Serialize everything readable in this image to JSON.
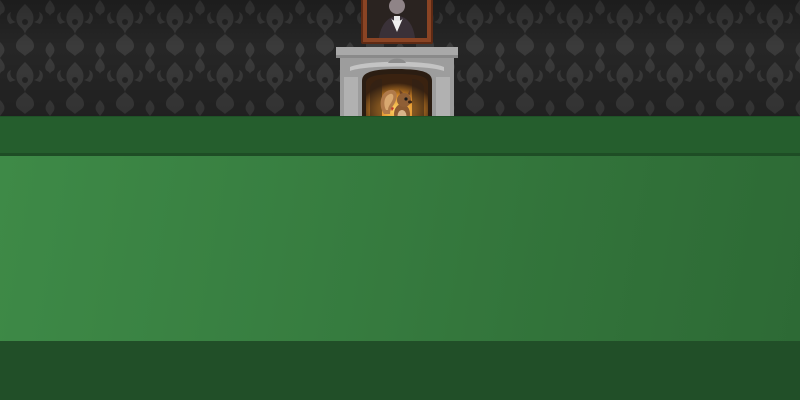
{
  "scene": {
    "type": "game-room",
    "background": "damask-wallpaper",
    "colors": {
      "wallpaper_base": "#262626",
      "wallpaper_pattern": "#3a3a3a",
      "back_ledge": "#255e2d",
      "felt": "#387f41",
      "front_ledge": "#214f28",
      "fireplace_stone": "#b5b5b5",
      "fire_glow": "#f2b632",
      "painting_frame": "#7a3a1e"
    }
  },
  "objects": {
    "painting": {
      "icon": "portrait-painting-icon"
    },
    "fireplace": {
      "icon": "fireplace-icon"
    },
    "character": {
      "icon": "squirrel-character-icon"
    }
  }
}
